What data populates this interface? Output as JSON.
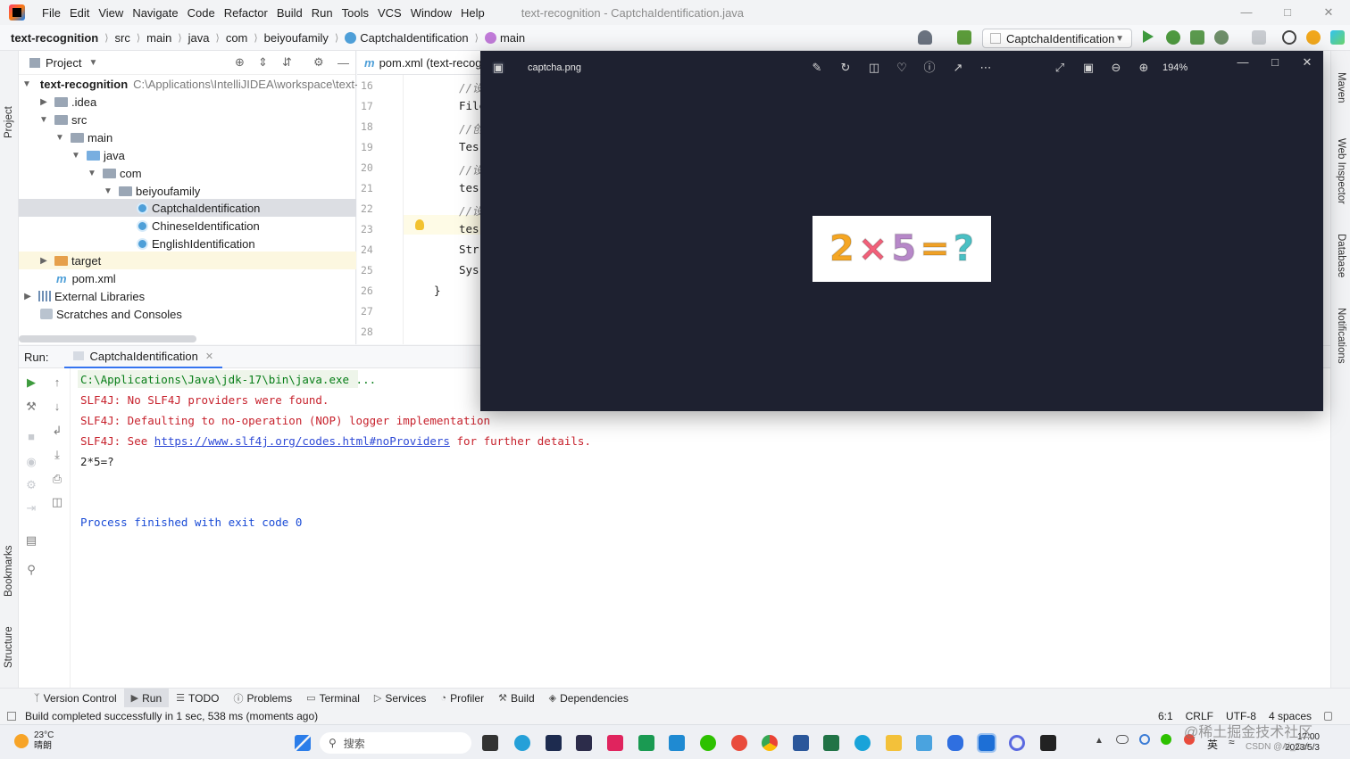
{
  "menu": {
    "items": [
      "File",
      "Edit",
      "View",
      "Navigate",
      "Code",
      "Refactor",
      "Build",
      "Run",
      "Tools",
      "VCS",
      "Window",
      "Help"
    ],
    "window_title": "text-recognition - CaptchaIdentification.java"
  },
  "nav": {
    "project": "text-recognition",
    "crumbs": [
      "src",
      "main",
      "java",
      "com",
      "beiyoufamily",
      "CaptchaIdentification",
      "main"
    ],
    "run_config": "CaptchaIdentification"
  },
  "stripes": {
    "left": [
      "Project",
      "Bookmarks",
      "Structure"
    ],
    "right": [
      "Maven",
      "Web Inspector",
      "Database",
      "Notifications"
    ]
  },
  "project_panel": {
    "title": "Project",
    "root": "text-recognition",
    "root_path": "C:\\Applications\\IntelliJIDEA\\workspace\\text-r",
    "items": [
      ".idea",
      "src",
      "main",
      "java",
      "com",
      "beiyoufamily",
      "CaptchaIdentification",
      "ChineseIdentification",
      "EnglishIdentification",
      "target",
      "pom.xml",
      "External Libraries",
      "Scratches and Consoles"
    ]
  },
  "editor": {
    "tab": "pom.xml (text-recogn",
    "line_numbers": [
      "16",
      "17",
      "18",
      "19",
      "20",
      "21",
      "22",
      "23",
      "24",
      "25",
      "26",
      "27",
      "28"
    ],
    "code_lines": [
      "//设",
      "File",
      "//创",
      "Tes",
      "//设",
      "tes",
      "//设",
      "tes",
      "Str",
      "Sys",
      "}"
    ]
  },
  "run": {
    "label": "Run:",
    "tab": "CaptchaIdentification",
    "console": {
      "cmd": "C:\\Applications\\Java\\jdk-17\\bin\\java.exe ...",
      "line1": "SLF4J: No SLF4J providers were found.",
      "line2": "SLF4J: Defaulting to no-operation (NOP) logger implementation",
      "line3_prefix": "SLF4J: See ",
      "line3_link": "https://www.slf4j.org/codes.html#noProviders",
      "line3_suffix": " for further details.",
      "result": "2*5=?",
      "exit": "Process finished with exit code 0"
    }
  },
  "bottom_tools": [
    "Version Control",
    "Run",
    "TODO",
    "Problems",
    "Terminal",
    "Services",
    "Profiler",
    "Build",
    "Dependencies"
  ],
  "status": {
    "message": "Build completed successfully in 1 sec, 538 ms (moments ago)",
    "position": "6:1",
    "line_sep": "CRLF",
    "encoding": "UTF-8",
    "indent": "4 spaces"
  },
  "taskbar": {
    "weather_temp": "23°C",
    "weather_desc": "晴朗",
    "search_placeholder": "搜索",
    "ime": "英",
    "time": "17:00",
    "date": "2023/5/3",
    "watermark": "@稀土掘金技术社区",
    "watermark2": "CSDN @Ai_Dai"
  },
  "viewer": {
    "title": "captcha.png",
    "zoom": "194%",
    "captcha_glyphs": [
      "2",
      "×",
      "5",
      "=",
      "?"
    ]
  },
  "colors": {
    "accent": "#3574f0",
    "error_text": "#c7222d",
    "viewer_bg": "#1e2130"
  }
}
